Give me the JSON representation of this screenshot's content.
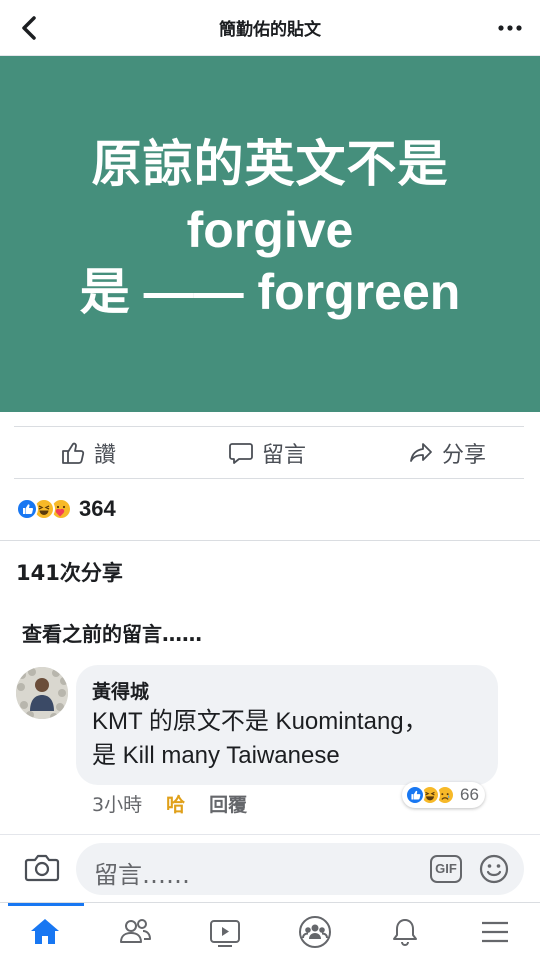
{
  "header": {
    "title": "簡勤佑的貼文"
  },
  "post": {
    "line1": "原諒的英文不是",
    "line2": "forgive",
    "line3": "是 —— forgreen",
    "background_color": "#458f7c"
  },
  "actions": {
    "like": "讚",
    "comment": "留言",
    "share": "分享"
  },
  "reactions": {
    "types": [
      "like",
      "haha",
      "care"
    ],
    "count": "364"
  },
  "shares_text": "141次分享",
  "prev_comments": "查看之前的留言……",
  "comment": {
    "author": "黃得城",
    "text_line1": "KMT 的原文不是 Kuomintang，",
    "text_line2": "是 Kill many Taiwanese",
    "time": "3小時",
    "my_reaction": "哈",
    "reply": "回覆",
    "reaction_count": "66",
    "reaction_types": [
      "like",
      "haha",
      "sad"
    ]
  },
  "composer": {
    "placeholder": "留言……",
    "gif_label": "GIF"
  },
  "bottom_nav": {
    "tabs": [
      "home",
      "friends",
      "watch",
      "groups",
      "notifications",
      "menu"
    ],
    "active": "home",
    "accent_color": "#1877f2"
  }
}
